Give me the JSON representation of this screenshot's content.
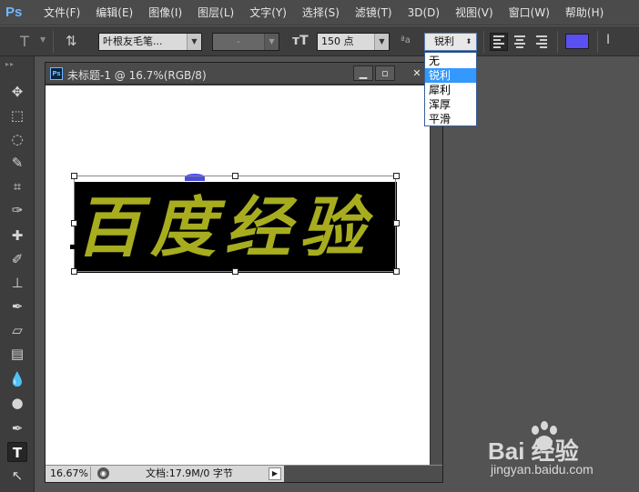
{
  "app": {
    "logo": "Ps"
  },
  "menu": [
    {
      "id": "file",
      "label": "文件(F)"
    },
    {
      "id": "edit",
      "label": "编辑(E)"
    },
    {
      "id": "image",
      "label": "图像(I)"
    },
    {
      "id": "layer",
      "label": "图层(L)"
    },
    {
      "id": "type",
      "label": "文字(Y)"
    },
    {
      "id": "select",
      "label": "选择(S)"
    },
    {
      "id": "filter",
      "label": "滤镜(T)"
    },
    {
      "id": "3d",
      "label": "3D(D)"
    },
    {
      "id": "view",
      "label": "视图(V)"
    },
    {
      "id": "window",
      "label": "窗口(W)"
    },
    {
      "id": "help",
      "label": "帮助(H)"
    }
  ],
  "options": {
    "font_family": "叶根友毛笔...",
    "font_style": "-",
    "font_size": "150 点",
    "antialias_icon_text": "a",
    "antialias_value": "锐利",
    "text_color": "#5a4ff0"
  },
  "antialias_dropdown": {
    "options": [
      "无",
      "锐利",
      "犀利",
      "浑厚",
      "平滑"
    ],
    "selected_index": 1
  },
  "document": {
    "title": "未标题-1 @ 16.7%(RGB/8)",
    "zoom": "16.67%",
    "doc_info": "文档:17.9M/0 字节",
    "text_content": "百度经验",
    "text_color": "#a7ad1e",
    "text_background": "#000000"
  },
  "watermark": {
    "logo_text": "Bai 经验",
    "url": "jingyan.baidu.com"
  }
}
